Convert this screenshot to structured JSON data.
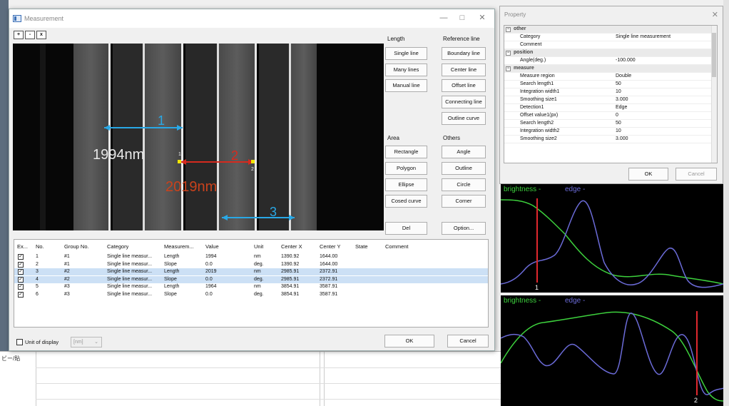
{
  "measurement_window": {
    "title": "Measurement",
    "toolbar": {
      "zoom_in": "+",
      "zoom_out": "-",
      "fit": "x"
    },
    "image_labels": {
      "m1_num": "1",
      "m1_value": "1994nm",
      "m2_num": "2",
      "m2_value": "2019nm",
      "m3_num": "3",
      "point1": "1",
      "point2": "2"
    },
    "length_group": {
      "title": "Length",
      "single_line": "Single line",
      "many_lines": "Many lines",
      "manual_line": "Manual line"
    },
    "reference_group": {
      "title": "Reference line",
      "boundary_line": "Boundary line",
      "center_line": "Center line",
      "offset_line": "Offset line",
      "connecting_line": "Connecting line",
      "outline_curve": "Outline curve"
    },
    "area_group": {
      "title": "Area",
      "rectangle": "Rectangle",
      "polygon": "Polygon",
      "ellipse": "Ellipse",
      "closed_curve": "Cosed curve"
    },
    "others_group": {
      "title": "Others",
      "angle": "Angle",
      "outline": "Outline",
      "circle": "Circle",
      "corner": "Corner"
    },
    "del_button": "Del",
    "option_button": "Option...",
    "table": {
      "headers": [
        "Ex...",
        "No.",
        "Group No.",
        "Category",
        "Measurem...",
        "Value",
        "Unit",
        "Center X",
        "Center Y",
        "State",
        "Comment"
      ],
      "rows": [
        [
          "1",
          "#1",
          "Single line measur...",
          "Length",
          "1994",
          "nm",
          "1390.92",
          "1644.00"
        ],
        [
          "2",
          "#1",
          "Single line measur...",
          "Slope",
          "0.0",
          "deg.",
          "1390.92",
          "1644.00"
        ],
        [
          "3",
          "#2",
          "Single line measur...",
          "Length",
          "2019",
          "nm",
          "2985.91",
          "2372.91"
        ],
        [
          "4",
          "#2",
          "Single line measur...",
          "Slope",
          "0.0",
          "deg.",
          "2985.91",
          "2372.91"
        ],
        [
          "5",
          "#3",
          "Single line measur...",
          "Length",
          "1964",
          "nm",
          "3854.91",
          "3587.91"
        ],
        [
          "6",
          "#3",
          "Single line measur...",
          "Slope",
          "0.0",
          "deg.",
          "3854.91",
          "3587.91"
        ]
      ],
      "check_mark": "✓"
    },
    "unit_label": "Unit of display",
    "unit_value": "[nm]",
    "ok": "OK",
    "cancel": "Cancel"
  },
  "property_window": {
    "title": "Property",
    "rows": [
      {
        "section": true,
        "key": "other",
        "toggle": "−"
      },
      {
        "key": "Category",
        "value": "Single line measurement"
      },
      {
        "key": "Comment",
        "value": ""
      },
      {
        "section": true,
        "key": "position",
        "toggle": "−"
      },
      {
        "key": "Angle(deg.)",
        "value": "-100.000"
      },
      {
        "section": true,
        "key": "measure",
        "toggle": "−"
      },
      {
        "key": "Measure region",
        "value": "Double"
      },
      {
        "key": "Search length1",
        "value": "50"
      },
      {
        "key": "Integration width1",
        "value": "10"
      },
      {
        "key": "Smoothing size1",
        "value": "3.000"
      },
      {
        "key": "Detection1",
        "value": "Edge"
      },
      {
        "key": "Offset value1(px)",
        "value": "0"
      },
      {
        "key": "Search length2",
        "value": "50"
      },
      {
        "key": "Integration width2",
        "value": "10"
      },
      {
        "key": "Smoothing size2",
        "value": "3.000"
      }
    ],
    "ok": "OK",
    "cancel": "Cancel"
  },
  "graph_top": {
    "brightness": "brightness -",
    "edge": "edge -",
    "marker": "1"
  },
  "graph_bottom": {
    "brightness": "brightness -",
    "edge": "edge -",
    "marker": "2"
  },
  "background": {
    "sheet_label": "ビー/貼"
  },
  "colors": {
    "brightness": "#3dd13d",
    "edge": "#6b6bd8",
    "marker": "#e0282e",
    "measure_cyan": "#29a8e6",
    "measure_red": "#d62a1e"
  }
}
